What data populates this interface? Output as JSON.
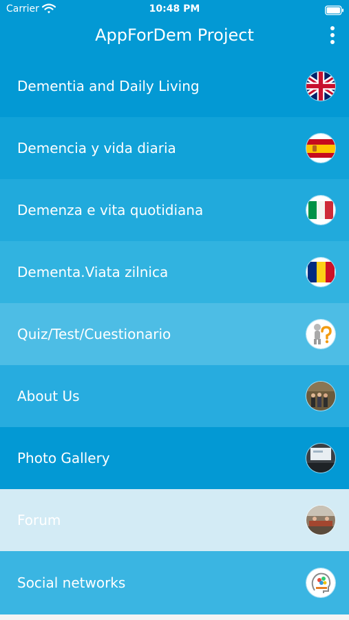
{
  "status_bar": {
    "carrier": "Carrier",
    "time": "10:48 PM"
  },
  "header": {
    "title": "AppForDem Project"
  },
  "menu": {
    "items": [
      {
        "label": "Dementia and Daily Living",
        "icon": "uk-flag-icon",
        "color": "#0399d4"
      },
      {
        "label": "Demencia y vida diaria",
        "icon": "spain-flag-icon",
        "color": "#11a2d8"
      },
      {
        "label": "Demenza e vita quotidiana",
        "icon": "italy-flag-icon",
        "color": "#21aadc"
      },
      {
        "label": "Dementa.Viata zilnica",
        "icon": "romania-flag-icon",
        "color": "#31b3e0"
      },
      {
        "label": "Quiz/Test/Cuestionario",
        "icon": "quiz-question-icon",
        "color": "#4dbde5"
      },
      {
        "label": "About Us",
        "icon": "about-us-photo-icon",
        "color": "#27acdf"
      },
      {
        "label": "Photo Gallery",
        "icon": "photo-gallery-icon",
        "color": "#0399d4"
      },
      {
        "label": "Forum",
        "icon": "forum-photo-icon",
        "color": "#d3ebf5"
      },
      {
        "label": "Social networks",
        "icon": "social-networks-logo-icon",
        "color": "#3ab5e2"
      }
    ]
  }
}
